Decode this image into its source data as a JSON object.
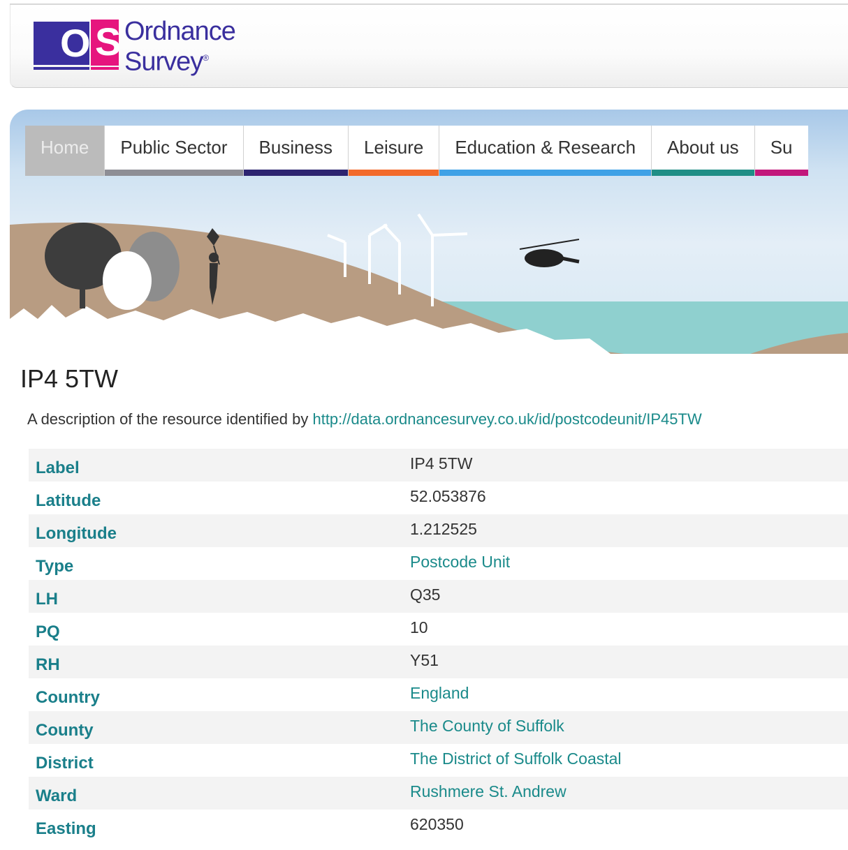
{
  "logo": {
    "glyph_o": "O",
    "glyph_s": "S",
    "name_line1": "Ordnance",
    "name_line2": "Survey",
    "mark": "®"
  },
  "nav": {
    "items": [
      {
        "label": "Home",
        "color": "#bbbbbb"
      },
      {
        "label": "Public Sector",
        "color": "#8e8e95"
      },
      {
        "label": "Business",
        "color": "#2d2470"
      },
      {
        "label": "Leisure",
        "color": "#f26a2b"
      },
      {
        "label": "Education & Research",
        "color": "#3fa1e6"
      },
      {
        "label": "About us",
        "color": "#1f8e86"
      },
      {
        "label": "Su",
        "color": "#c2177b"
      }
    ]
  },
  "page": {
    "title": "IP4 5TW",
    "description_prefix": "A description of the resource identified by ",
    "resource_url": "http://data.ordnancesurvey.co.uk/id/postcodeunit/IP45TW"
  },
  "properties": [
    {
      "key": "Label",
      "value": "IP4 5TW",
      "link": false
    },
    {
      "key": "Latitude",
      "value": "52.053876",
      "link": false
    },
    {
      "key": "Longitude",
      "value": "1.212525",
      "link": false
    },
    {
      "key": "Type",
      "value": "Postcode Unit",
      "link": true
    },
    {
      "key": "LH",
      "value": "Q35",
      "link": false
    },
    {
      "key": "PQ",
      "value": "10",
      "link": false
    },
    {
      "key": "RH",
      "value": "Y51",
      "link": false
    },
    {
      "key": "Country",
      "value": "England",
      "link": true
    },
    {
      "key": "County",
      "value": "The County of Suffolk",
      "link": true
    },
    {
      "key": "District",
      "value": "The District of Suffolk Coastal",
      "link": true
    },
    {
      "key": "Ward",
      "value": "Rushmere St. Andrew",
      "link": true
    },
    {
      "key": "Easting",
      "value": "620350",
      "link": false
    }
  ],
  "colors": {
    "brand_blue": "#3a2f9e",
    "brand_pink": "#e6157e",
    "teal": "#1a7f8a"
  }
}
